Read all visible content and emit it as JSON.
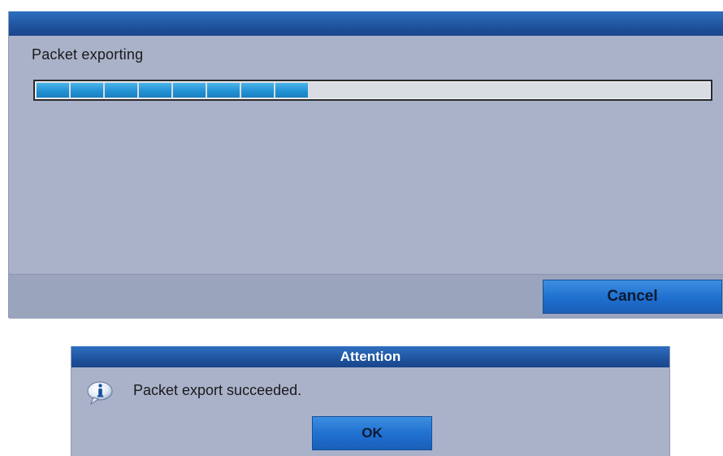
{
  "export_dialog": {
    "status_label": "Packet exporting",
    "progress": {
      "fraction": 0.4,
      "segments_filled": 8,
      "fill_color": "#1f90d2",
      "track_color": "#d9dde3"
    },
    "cancel_label": "Cancel"
  },
  "attention_dialog": {
    "title": "Attention",
    "icon": "info-icon",
    "message": "Packet export succeeded.",
    "ok_label": "OK"
  },
  "colors": {
    "titlebar": "#1d4f99",
    "dialog_background": "#aab2ca",
    "button": "#1f6fcf"
  }
}
